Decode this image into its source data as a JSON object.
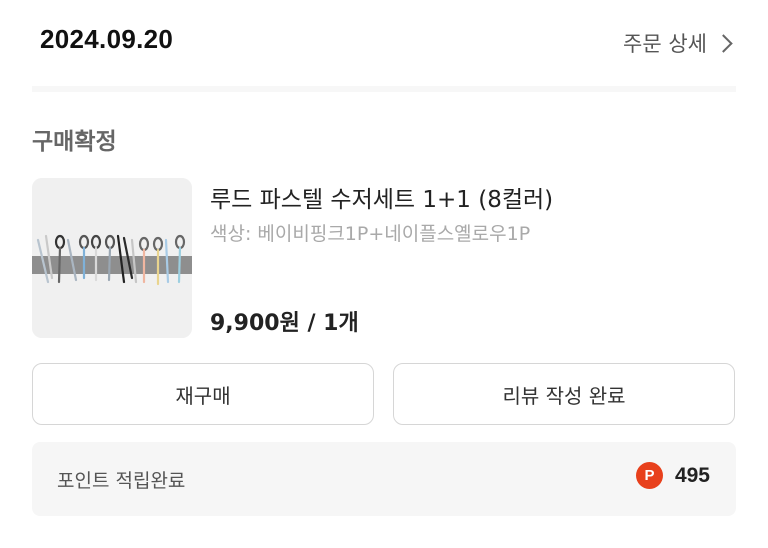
{
  "order": {
    "date": "2024.09.20",
    "detail_link": "주문 상세"
  },
  "status": "구매확정",
  "product": {
    "name": "루드 파스텔 수저세트 1+1 (8컬러)",
    "option": "색상: 베이비핑크1P+네이플스옐로우1P",
    "price": "9,900원 / 1개",
    "image_alt": "colorful-spoon-chopstick-set-photo"
  },
  "actions": {
    "rebuy_label": "재구매",
    "review_label": "리뷰 작성 완료"
  },
  "points": {
    "label": "포인트 적립완료",
    "icon_letter": "P",
    "value": "495",
    "icon_color": "#e8401c"
  }
}
